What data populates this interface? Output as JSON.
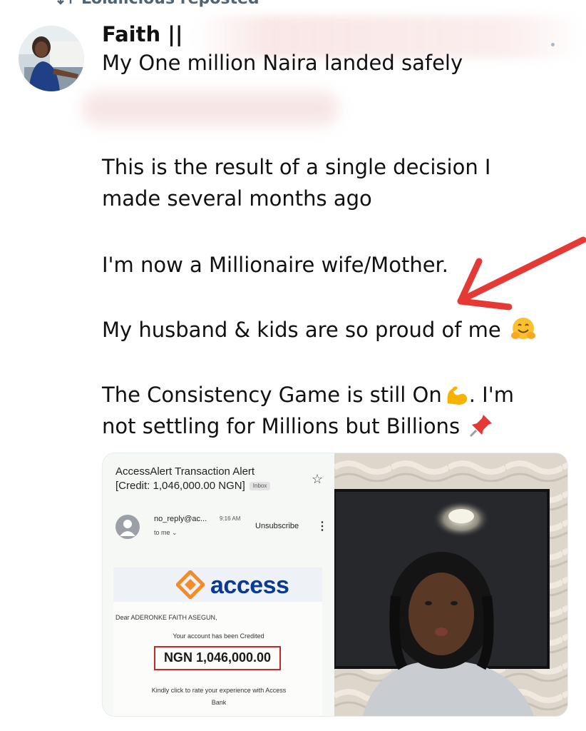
{
  "repost": {
    "label": "Lolalicious reposted"
  },
  "tweet": {
    "author_name": "Faith ||",
    "headline": "My One million Naira landed safely",
    "lines": [
      "This is the result of a single decision I",
      "made several months ago",
      "I'm now a Millionaire wife/Mother.",
      "My husband & kids are so proud of me",
      "The Consistency Game is still On",
      ". I'm",
      "not settling for Millions but Billions"
    ],
    "emojis": [
      "hugging-face-icon",
      "flexed-biceps-icon",
      "pushpin-icon"
    ]
  },
  "email": {
    "subject_line1": "AccessAlert Transaction Alert",
    "subject_line2": "[Credit: 1,046,000.00 NGN]",
    "inbox_badge": "Inbox",
    "sender": "no_reply@ac...",
    "time": "9:16 AM",
    "to": "to me",
    "unsubscribe": "Unsubscribe",
    "bank_name": "access",
    "greeting": "Dear ADERONKE FAITH ASEGUN,",
    "credited_msg": "Your account has been Credited",
    "amount": "NGN 1,046,000.00",
    "rate_line1": "Kindly click to rate your experience with Access",
    "rate_line2": "Bank"
  },
  "colors": {
    "arrow": "#e53935",
    "bank_blue": "#0b3b8f",
    "bank_orange": "#f28c28",
    "highlight_box": "#c62828"
  }
}
